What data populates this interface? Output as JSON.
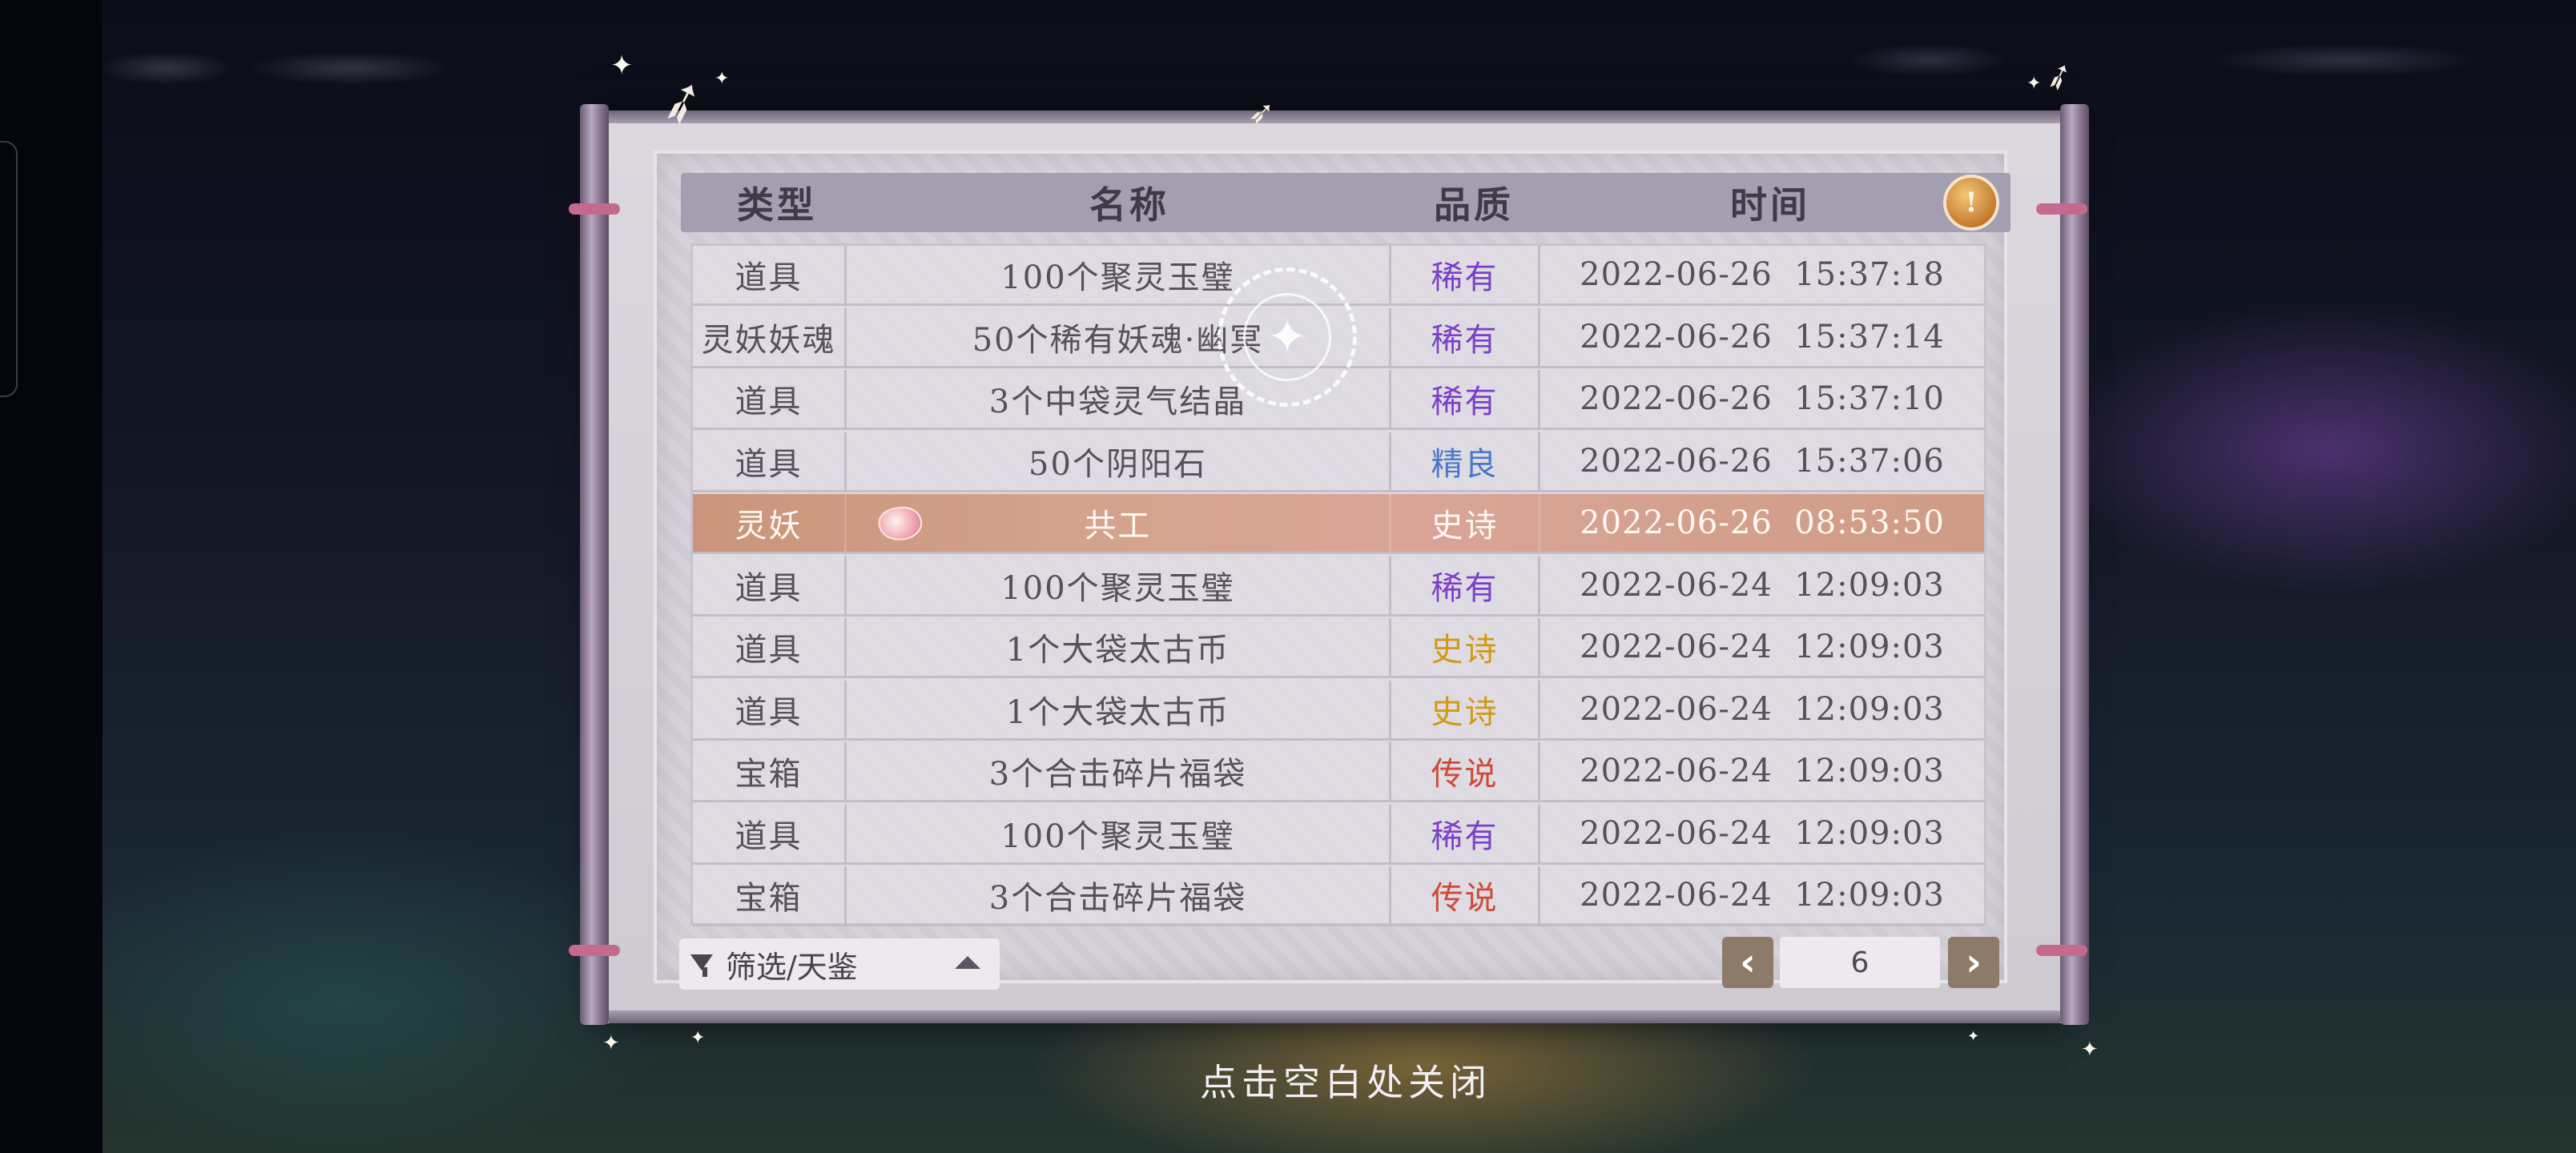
{
  "table": {
    "headers": {
      "type": "类型",
      "name": "名称",
      "quality": "品质",
      "time": "时间"
    },
    "rows": [
      {
        "type": "道具",
        "name": "100个聚灵玉璧",
        "quality": "稀有",
        "quality_color": "#7b3fc9",
        "time": "2022-06-26  15:37:18"
      },
      {
        "type": "灵妖妖魂",
        "name": "50个稀有妖魂·幽冥",
        "quality": "稀有",
        "quality_color": "#7b3fc9",
        "time": "2022-06-26  15:37:14"
      },
      {
        "type": "道具",
        "name": "3个中袋灵气结晶",
        "quality": "稀有",
        "quality_color": "#7b3fc9",
        "time": "2022-06-26  15:37:10"
      },
      {
        "type": "道具",
        "name": "50个阴阳石",
        "quality": "精良",
        "quality_color": "#4a78c9",
        "time": "2022-06-26  15:37:06"
      },
      {
        "type": "灵妖",
        "name": "共工",
        "quality": "史诗",
        "quality_color": "#fff8f2",
        "time": "2022-06-26  08:53:50",
        "highlight": true
      },
      {
        "type": "道具",
        "name": "100个聚灵玉璧",
        "quality": "稀有",
        "quality_color": "#7b3fc9",
        "time": "2022-06-24  12:09:03"
      },
      {
        "type": "道具",
        "name": "1个大袋太古币",
        "quality": "史诗",
        "quality_color": "#d19a12",
        "time": "2022-06-24  12:09:03"
      },
      {
        "type": "道具",
        "name": "1个大袋太古币",
        "quality": "史诗",
        "quality_color": "#d19a12",
        "time": "2022-06-24  12:09:03"
      },
      {
        "type": "宝箱",
        "name": "3个合击碎片福袋",
        "quality": "传说",
        "quality_color": "#cf4a3a",
        "time": "2022-06-24  12:09:03"
      },
      {
        "type": "道具",
        "name": "100个聚灵玉璧",
        "quality": "稀有",
        "quality_color": "#7b3fc9",
        "time": "2022-06-24  12:09:03"
      },
      {
        "type": "宝箱",
        "name": "3个合击碎片福袋",
        "quality": "传说",
        "quality_color": "#cf4a3a",
        "time": "2022-06-24  12:09:03"
      }
    ]
  },
  "filter": {
    "label": "筛选/天鉴",
    "icon": "funnel-icon"
  },
  "pager": {
    "prev": "‹",
    "next": "›",
    "page": "6"
  },
  "info_icon": "!",
  "close_hint": "点击空白处关闭"
}
